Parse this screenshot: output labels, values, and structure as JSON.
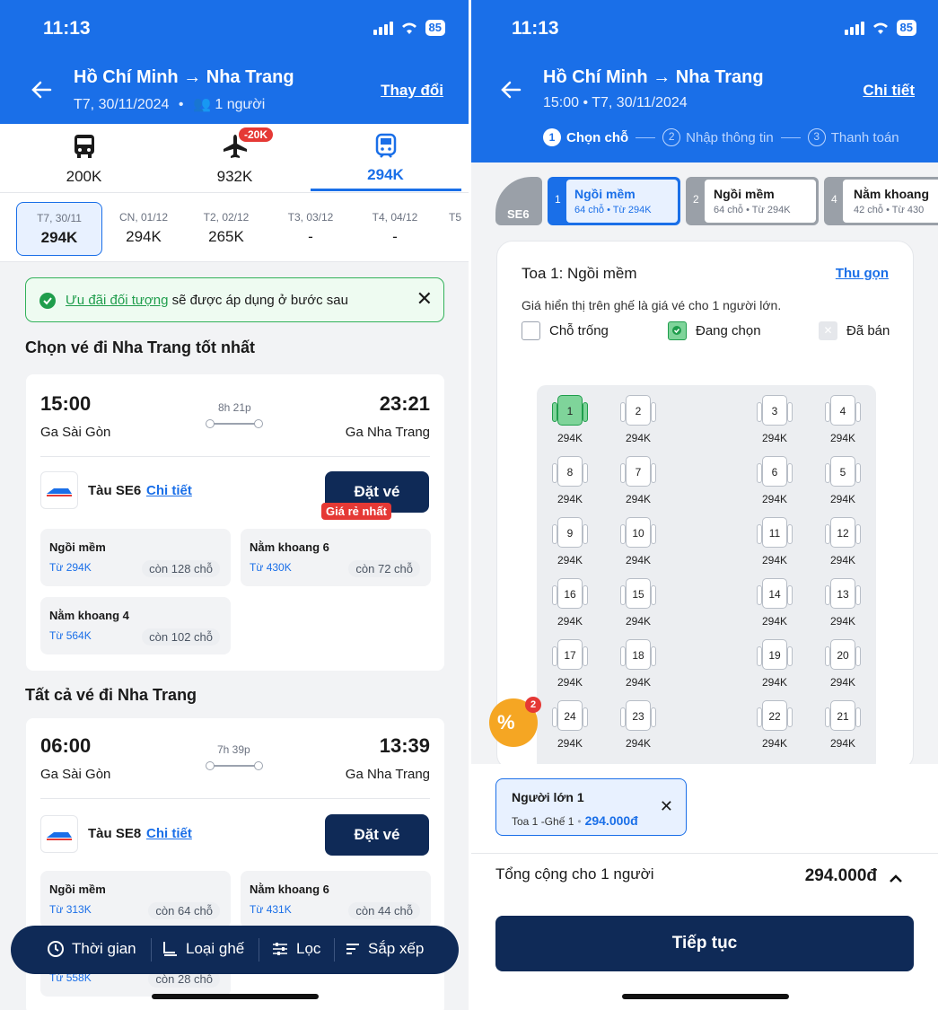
{
  "left": {
    "status": {
      "time": "11:13",
      "battery": "85"
    },
    "header": {
      "route": "Hồ Chí Minh → Nha Trang",
      "date": "T7, 30/11/2024",
      "passengers": "1 người",
      "change_link": "Thay đổi"
    },
    "modes": [
      {
        "icon": "bus-icon",
        "price": "200K",
        "badge": ""
      },
      {
        "icon": "plane-icon",
        "price": "932K",
        "badge": "-20K"
      },
      {
        "icon": "train-icon",
        "price": "294K",
        "badge": ""
      }
    ],
    "dates": [
      {
        "day": "T7, 30/11",
        "price": "294K"
      },
      {
        "day": "CN, 01/12",
        "price": "294K"
      },
      {
        "day": "T2, 02/12",
        "price": "265K"
      },
      {
        "day": "T3, 03/12",
        "price": "-"
      },
      {
        "day": "T4, 04/12",
        "price": "-"
      },
      {
        "day": "T5",
        "price": ""
      }
    ],
    "promo": {
      "link": "Ưu đãi đối tượng",
      "text": " sẽ được áp dụng ở bước sau"
    },
    "best_title": "Chọn vé đi Nha Trang tốt nhất",
    "trip1": {
      "depart": "15:00",
      "arrive": "23:21",
      "duration": "8h 21p",
      "from": "Ga Sài Gòn",
      "to": "Ga Nha Trang",
      "train": "Tàu SE6",
      "detail": "Chi tiết",
      "book": "Đặt vé",
      "cheap": "Giá rẻ nhất",
      "classes": [
        {
          "name": "Ngồi mềm",
          "from": "Từ 294K",
          "left": "còn 128 chỗ"
        },
        {
          "name": "Nằm khoang 6",
          "from": "Từ 430K",
          "left": "còn 72 chỗ"
        },
        {
          "name": "Nằm khoang 4",
          "from": "Từ 564K",
          "left": "còn 102 chỗ"
        }
      ]
    },
    "all_title": "Tất cả vé đi Nha Trang",
    "trip2": {
      "depart": "06:00",
      "arrive": "13:39",
      "duration": "7h 39p",
      "from": "Ga Sài Gòn",
      "to": "Ga Nha Trang",
      "train": "Tàu SE8",
      "detail": "Chi tiết",
      "book": "Đặt vé",
      "classes": [
        {
          "name": "Ngồi mềm",
          "from": "Từ 313K",
          "left": "còn 64 chỗ"
        },
        {
          "name": "Nằm khoang 6",
          "from": "Từ 431K",
          "left": "còn 44 chỗ"
        },
        {
          "name": "",
          "from": "Từ 558K",
          "left": "còn 28 chỗ"
        }
      ]
    },
    "toolbar": {
      "time": "Thời gian",
      "seat": "Loại ghế",
      "filter": "Lọc",
      "sort": "Sắp xếp"
    }
  },
  "right": {
    "status": {
      "time": "11:13",
      "battery": "85"
    },
    "header": {
      "route": "Hồ Chí Minh → Nha Trang",
      "sub": "15:00 • T7, 30/11/2024",
      "detail_link": "Chi tiết"
    },
    "steps": [
      {
        "n": "1",
        "label": "Chọn chỗ"
      },
      {
        "n": "2",
        "label": "Nhập thông tin"
      },
      {
        "n": "3",
        "label": "Thanh toán"
      }
    ],
    "train_code": "SE6",
    "cars": [
      {
        "n": "1",
        "name": "Ngồi mềm",
        "info": "64 chỗ • Từ 294K"
      },
      {
        "n": "2",
        "name": "Ngồi mềm",
        "info": "64 chỗ • Từ 294K"
      },
      {
        "n": "4",
        "name": "Nằm khoang",
        "info": "42 chỗ • Từ 430"
      }
    ],
    "coach": {
      "title": "Toa 1: Ngồi mềm",
      "collapse": "Thu gọn",
      "note": "Giá hiển thị trên ghế là giá vé cho 1 người lớn.",
      "legend_free": "Chỗ trống",
      "legend_sel": "Đang chọn",
      "legend_sold": "Đã bán"
    },
    "seats": [
      [
        "1",
        "2",
        "3",
        "4"
      ],
      [
        "8",
        "7",
        "6",
        "5"
      ],
      [
        "9",
        "10",
        "11",
        "12"
      ],
      [
        "16",
        "15",
        "14",
        "13"
      ],
      [
        "17",
        "18",
        "19",
        "20"
      ],
      [
        "24",
        "23",
        "22",
        "21"
      ]
    ],
    "seat_price": "294K",
    "promo_badge": "2",
    "passenger": {
      "title": "Người lớn 1",
      "detail": "Toa 1 -Ghế 1",
      "price": "294.000đ"
    },
    "total": {
      "label": "Tổng cộng cho 1 người",
      "value": "294.000đ"
    },
    "continue": "Tiếp tục"
  }
}
